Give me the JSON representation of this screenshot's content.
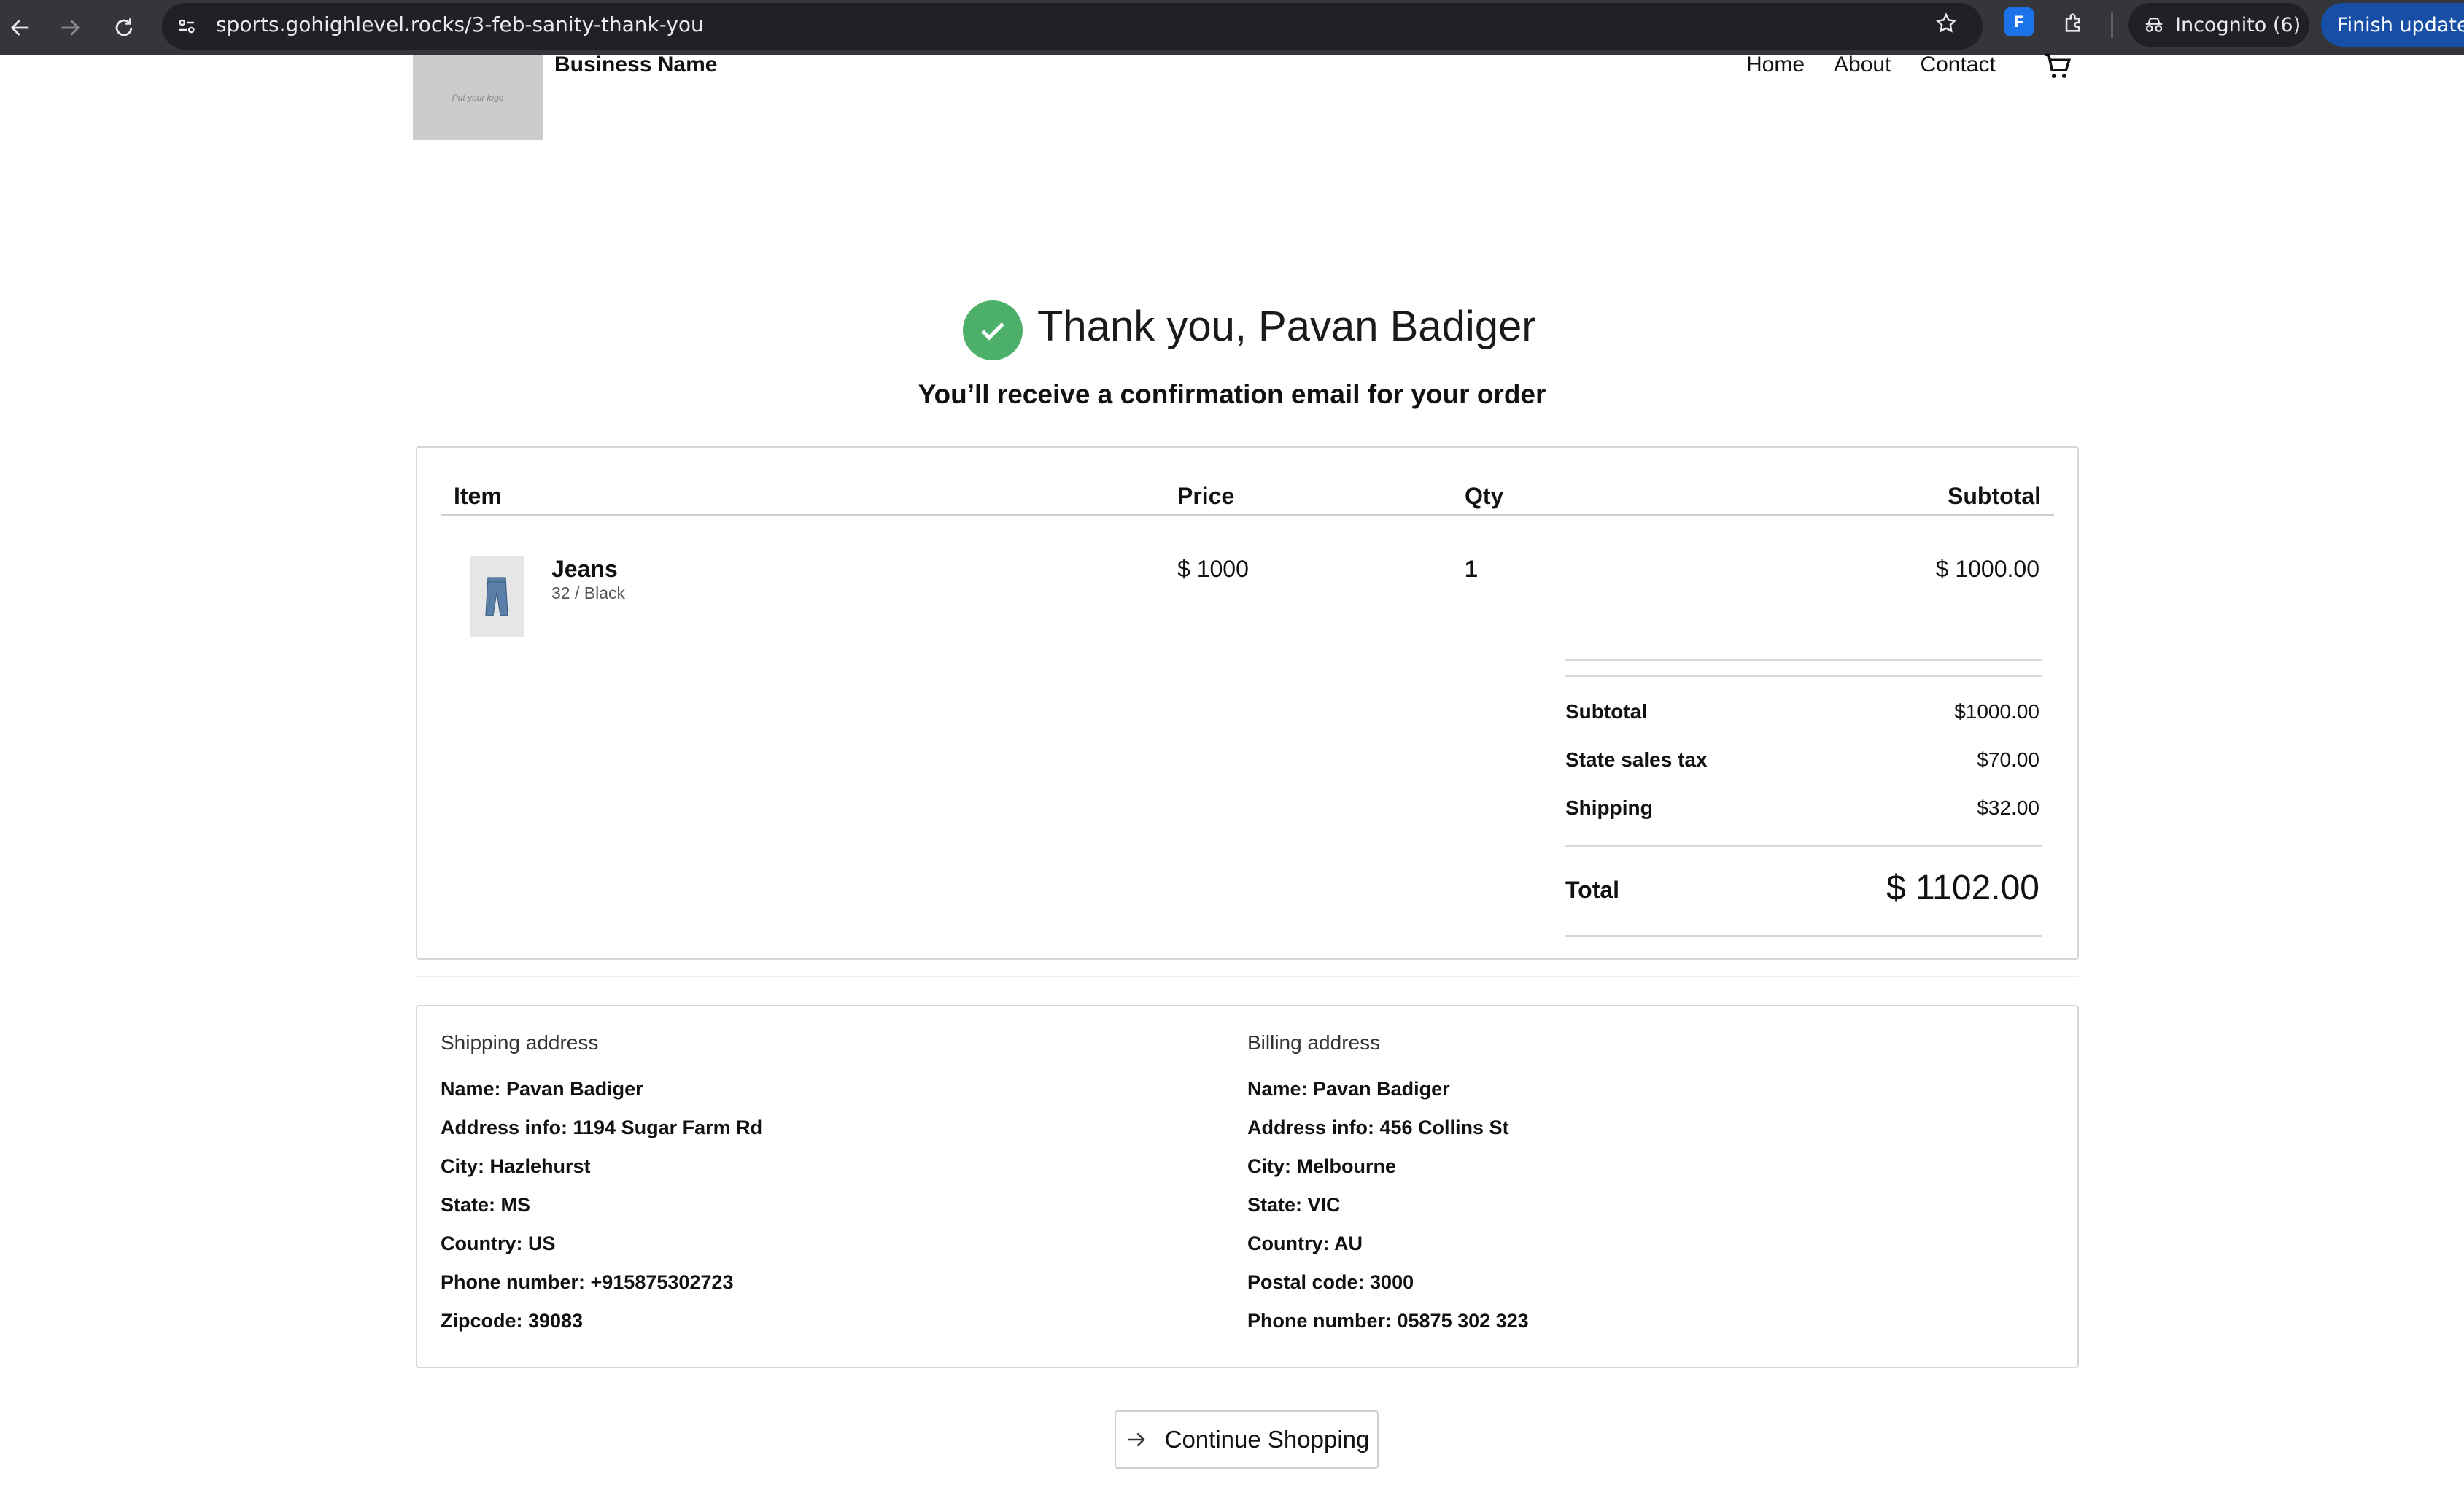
{
  "browser": {
    "url": "sports.gohighlevel.rocks/3-feb-sanity-thank-you",
    "incognito_label": "Incognito (6)",
    "update_label": "Finish update",
    "extension_letter": "F"
  },
  "header": {
    "logo_text": "Put your logo",
    "business_name": "Business Name",
    "nav": [
      "Home",
      "About",
      "Contact"
    ]
  },
  "thank_you": {
    "title": "Thank you, Pavan Badiger",
    "subtitle": "You’ll receive a confirmation email for your order",
    "check_color": "#4caf6a"
  },
  "order": {
    "columns": [
      "Item",
      "Price",
      "Qty",
      "Subtotal"
    ],
    "items": [
      {
        "name": "Jeans",
        "variant": "32 / Black",
        "price": "$ 1000",
        "qty": "1",
        "subtotal": "$ 1000.00"
      }
    ],
    "summary": [
      {
        "label": "Subtotal",
        "value": "$1000.00"
      },
      {
        "label": "State sales tax",
        "value": "$70.00"
      },
      {
        "label": "Shipping",
        "value": "$32.00"
      }
    ],
    "total_label": "Total",
    "total_value": "$ 1102.00"
  },
  "shipping": {
    "title": "Shipping address",
    "lines": [
      "Name:  Pavan Badiger",
      "Address info:  1194 Sugar Farm Rd",
      "City: Hazlehurst",
      "State:  MS",
      "Country: US",
      "Phone number:  +915875302723",
      "Zipcode:  39083"
    ]
  },
  "billing": {
    "title": "Billing address",
    "lines": [
      "Name:  Pavan Badiger",
      "Address info:  456 Collins St",
      "City: Melbourne",
      "State:  VIC",
      "Country: AU",
      "Postal code: 3000",
      "Phone number:  05875 302 323"
    ]
  },
  "continue_label": "Continue Shopping"
}
